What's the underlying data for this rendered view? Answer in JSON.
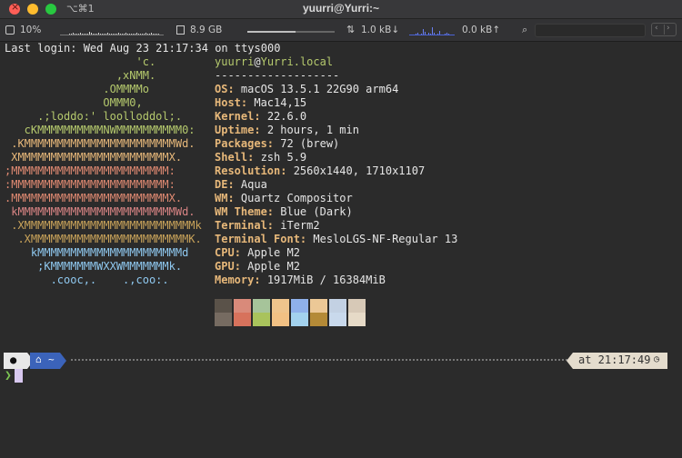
{
  "titlebar": {
    "tab_shortcut": "⌥⌘1",
    "title": "yuurri@Yurri:~"
  },
  "status": {
    "cpu": "10%",
    "memory": "8.9 GB",
    "memory_used_fraction": 0.55,
    "download": "1.0 kB↓",
    "upload": "0.0 kB↑",
    "icons": [
      "cpu-icon",
      "memory-icon",
      "network-icon",
      "search-icon"
    ]
  },
  "terminal": {
    "last_login": "Last login: Wed Aug 23 21:17:34 on ttys000",
    "ascii": [
      {
        "text": "                    'c.",
        "color": "#b5c96d"
      },
      {
        "text": "                 ,xNMM.",
        "color": "#b5c96d"
      },
      {
        "text": "               .OMMMMo",
        "color": "#b5c96d"
      },
      {
        "text": "               OMMM0,",
        "color": "#b5c96d"
      },
      {
        "text": "     .;loddo:' loolloddol;.",
        "color": "#b5c96d"
      },
      {
        "text": "   cKMMMMMMMMMMNWMMMMMMMMMM0:",
        "color": "#b5c96d"
      },
      {
        "text": " .KMMMMMMMMMMMMMMMMMMMMMMMWd.",
        "color": "#e7b87a"
      },
      {
        "text": " XMMMMMMMMMMMMMMMMMMMMMMMX.",
        "color": "#e7b87a"
      },
      {
        "text": ";MMMMMMMMMMMMMMMMMMMMMMMM:",
        "color": "#e08a72"
      },
      {
        "text": ":MMMMMMMMMMMMMMMMMMMMMMMM:",
        "color": "#e08a72"
      },
      {
        "text": ".MMMMMMMMMMMMMMMMMMMMMMMMX.",
        "color": "#e08a72"
      },
      {
        "text": " kMMMMMMMMMMMMMMMMMMMMMMMMWd.",
        "color": "#d88484"
      },
      {
        "text": " .XMMMMMMMMMMMMMMMMMMMMMMMMMMk",
        "color": "#c9a35a"
      },
      {
        "text": "  .XMMMMMMMMMMMMMMMMMMMMMMMMK.",
        "color": "#c9a35a"
      },
      {
        "text": "    kMMMMMMMMMMMMMMMMMMMMMMd",
        "color": "#8fc8ef"
      },
      {
        "text": "     ;KMMMMMMMWXXWMMMMMMMk.",
        "color": "#8fc8ef"
      },
      {
        "text": "       .cooc,.    .,coo:.",
        "color": "#8fc8ef"
      }
    ],
    "user": "yuurri",
    "at": "@",
    "host": "Yurri.local",
    "separator": "-------------------",
    "info": [
      {
        "key": "OS",
        "value": "macOS 13.5.1 22G90 arm64"
      },
      {
        "key": "Host",
        "value": "Mac14,15"
      },
      {
        "key": "Kernel",
        "value": "22.6.0"
      },
      {
        "key": "Uptime",
        "value": "2 hours, 1 min"
      },
      {
        "key": "Packages",
        "value": "72 (brew)"
      },
      {
        "key": "Shell",
        "value": "zsh 5.9"
      },
      {
        "key": "Resolution",
        "value": "2560x1440, 1710x1107"
      },
      {
        "key": "DE",
        "value": "Aqua"
      },
      {
        "key": "WM",
        "value": "Quartz Compositor"
      },
      {
        "key": "WM Theme",
        "value": "Blue (Dark)"
      },
      {
        "key": "Terminal",
        "value": "iTerm2"
      },
      {
        "key": "Terminal Font",
        "value": "MesloLGS-NF-Regular 13"
      },
      {
        "key": "CPU",
        "value": "Apple M2"
      },
      {
        "key": "GPU",
        "value": "Apple M2"
      },
      {
        "key": "Memory",
        "value": "1917MiB / 16384MiB"
      }
    ],
    "palette_top": [
      "#5a5249",
      "#d98a7a",
      "#a6c49a",
      "#efc48c",
      "#8fb1ea",
      "#ecc896",
      "#c3d1e3",
      "#d7c9b7"
    ],
    "palette_bottom": [
      "#766b61",
      "#d7725c",
      "#a9c35c",
      "#f2c184",
      "#a3d2ee",
      "#b48a37",
      "#c9d9ec",
      "#e6dac7"
    ]
  },
  "prompt": {
    "dir": "~",
    "time": "at 21:17:49",
    "chevron": "❯"
  }
}
